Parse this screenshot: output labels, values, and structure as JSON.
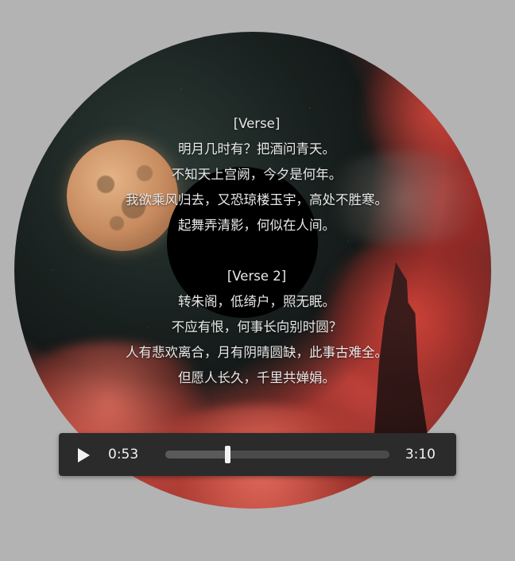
{
  "lyrics": {
    "lines": [
      "[Verse]",
      "明月几时有？把酒问青天。",
      "不知天上宫阙，今夕是何年。",
      "我欲乘风归去，又恐琼楼玉宇，高处不胜寒。",
      "起舞弄清影，何似在人间。",
      "",
      "[Verse 2]",
      "转朱阁，低绮户，照无眠。",
      "不应有恨，何事长向别时圆？",
      "人有悲欢离合，月有阴晴圆缺，此事古难全。",
      "但愿人长久，千里共婵娟。"
    ]
  },
  "player": {
    "play_icon": "play-icon",
    "current_time": "0:53",
    "total_time": "3:10",
    "progress_fraction": 0.279
  },
  "colors": {
    "page_background": "#b3b3b3",
    "player_background": "#2b2b2b",
    "player_text": "#f2f2f2"
  }
}
